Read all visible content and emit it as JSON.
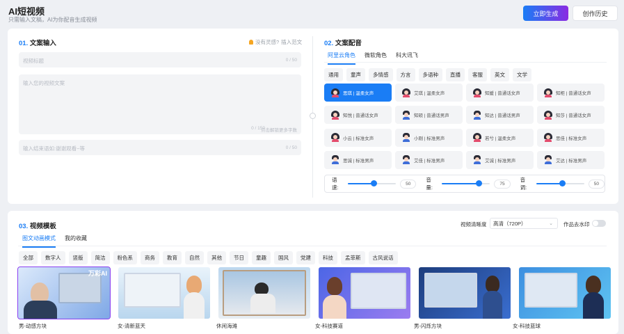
{
  "header": {
    "title": "AI短视频",
    "subtitle": "只需输入文稿，AI为你配音生成视频",
    "generate_label": "立即生成",
    "history_label": "创作历史"
  },
  "copy": {
    "num": "01.",
    "title": "文案输入",
    "hint": "没有灵感?",
    "insert_label": "插入范文",
    "title_placeholder": "视频标题",
    "title_count": "0 / 50",
    "body_placeholder": "输入您的视频文案",
    "body_count": "0 / 150",
    "body_hint": "点击解锁更多字数",
    "ending_placeholder": "输入结束语如:谢谢观看~等",
    "ending_count": "0 / 50"
  },
  "voice": {
    "num": "02.",
    "title": "文案配音",
    "tabs": [
      "阿里云角色",
      "微软角色",
      "科大讯飞"
    ],
    "categories": [
      "通用",
      "童声",
      "多情感",
      "方言",
      "多语种",
      "直播",
      "客服",
      "英文",
      "文学"
    ],
    "voices": [
      {
        "label": "思琪 | 温柔女声",
        "gender": "f",
        "selected": true
      },
      {
        "label": "艾琪 | 温柔女声",
        "gender": "f"
      },
      {
        "label": "知媛 | 普通话女声",
        "gender": "f"
      },
      {
        "label": "知柜 | 普通话女声",
        "gender": "f"
      },
      {
        "label": "知悦 | 普通话女声",
        "gender": "f"
      },
      {
        "label": "知硕 | 普通话男声",
        "gender": "m"
      },
      {
        "label": "知达 | 普通话男声",
        "gender": "m"
      },
      {
        "label": "知莎 | 普通话女声",
        "gender": "f"
      },
      {
        "label": "小云 | 标准女声",
        "gender": "f"
      },
      {
        "label": "小刚 | 标准男声",
        "gender": "m"
      },
      {
        "label": "若兮 | 温柔女声",
        "gender": "f"
      },
      {
        "label": "思佳 | 标准女声",
        "gender": "f"
      },
      {
        "label": "思诚 | 标准男声",
        "gender": "m"
      },
      {
        "label": "艾佳 | 标准男声",
        "gender": "m"
      },
      {
        "label": "艾诚 | 标准男声",
        "gender": "m"
      },
      {
        "label": "艾达 | 标准男声",
        "gender": "m"
      }
    ],
    "speed_label": "语速:",
    "speed": 50,
    "volume_label": "音量:",
    "volume": 75,
    "pitch_label": "音调:",
    "pitch": 50
  },
  "template": {
    "num": "03.",
    "title": "视频模板",
    "resolution_label": "视频清晰度",
    "resolution_value": "高清（720P）",
    "watermark_label": "作品去水印",
    "tabs": [
      "图文动画模式",
      "我的收藏"
    ],
    "categories": [
      "全部",
      "数字人",
      "竖版",
      "简洁",
      "粉色系",
      "商务",
      "教育",
      "自然",
      "其他",
      "节日",
      "童趣",
      "国风",
      "党建",
      "科技",
      "孟菲斯",
      "古风说话"
    ],
    "thumbs": [
      {
        "label": "男-动感方块",
        "logo": "万彩AI"
      },
      {
        "label": "女-清新蓝天"
      },
      {
        "label": "休闲海滩"
      },
      {
        "label": "女-科技赛道"
      },
      {
        "label": "男-闪烁方块"
      },
      {
        "label": "女-科技蓝球"
      }
    ]
  },
  "colors": {
    "accent": "#1a7df5",
    "gradient_end": "#8a2be2"
  }
}
